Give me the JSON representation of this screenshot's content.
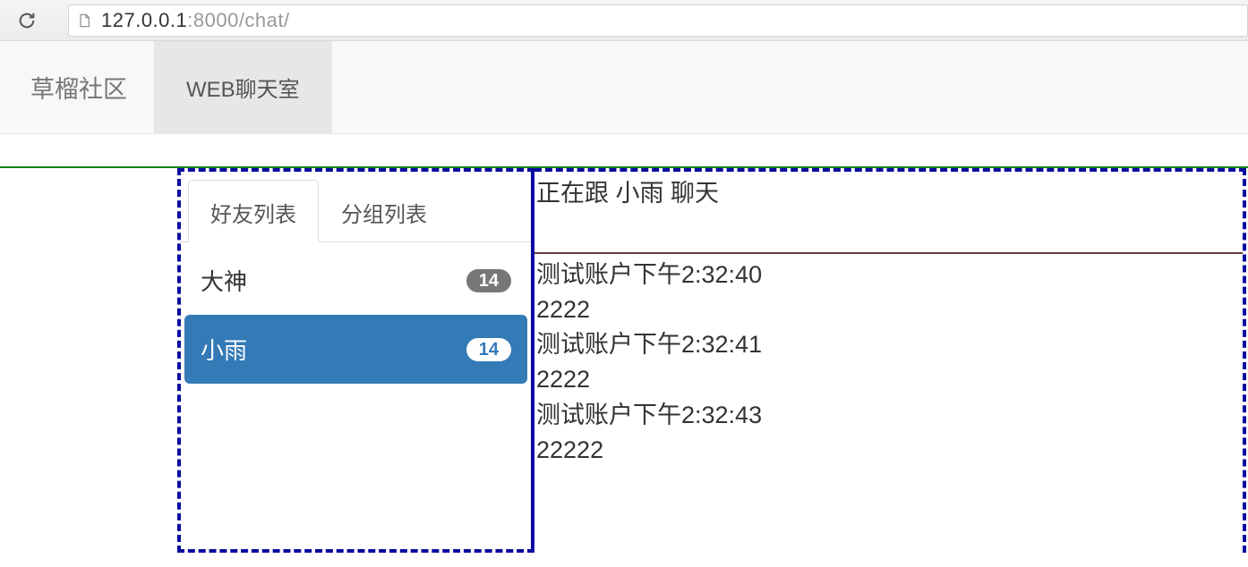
{
  "browser": {
    "url_host": "127.0.0.1",
    "url_port": ":8000",
    "url_path": "/chat/"
  },
  "topnav": {
    "brand": "草榴社区",
    "items": [
      {
        "label": "WEB聊天室",
        "active": true
      }
    ]
  },
  "sidebar": {
    "tabs": [
      {
        "label": "好友列表",
        "active": true
      },
      {
        "label": "分组列表",
        "active": false
      }
    ],
    "friends": [
      {
        "name": "大神",
        "badge": "14",
        "selected": false
      },
      {
        "name": "小雨",
        "badge": "14",
        "selected": true
      }
    ]
  },
  "chat": {
    "header": "正在跟 小雨 聊天",
    "messages": [
      {
        "meta": "测试账户下午2:32:40",
        "text": "2222"
      },
      {
        "meta": "测试账户下午2:32:41",
        "text": "2222"
      },
      {
        "meta": "测试账户下午2:32:43",
        "text": "22222"
      }
    ]
  }
}
